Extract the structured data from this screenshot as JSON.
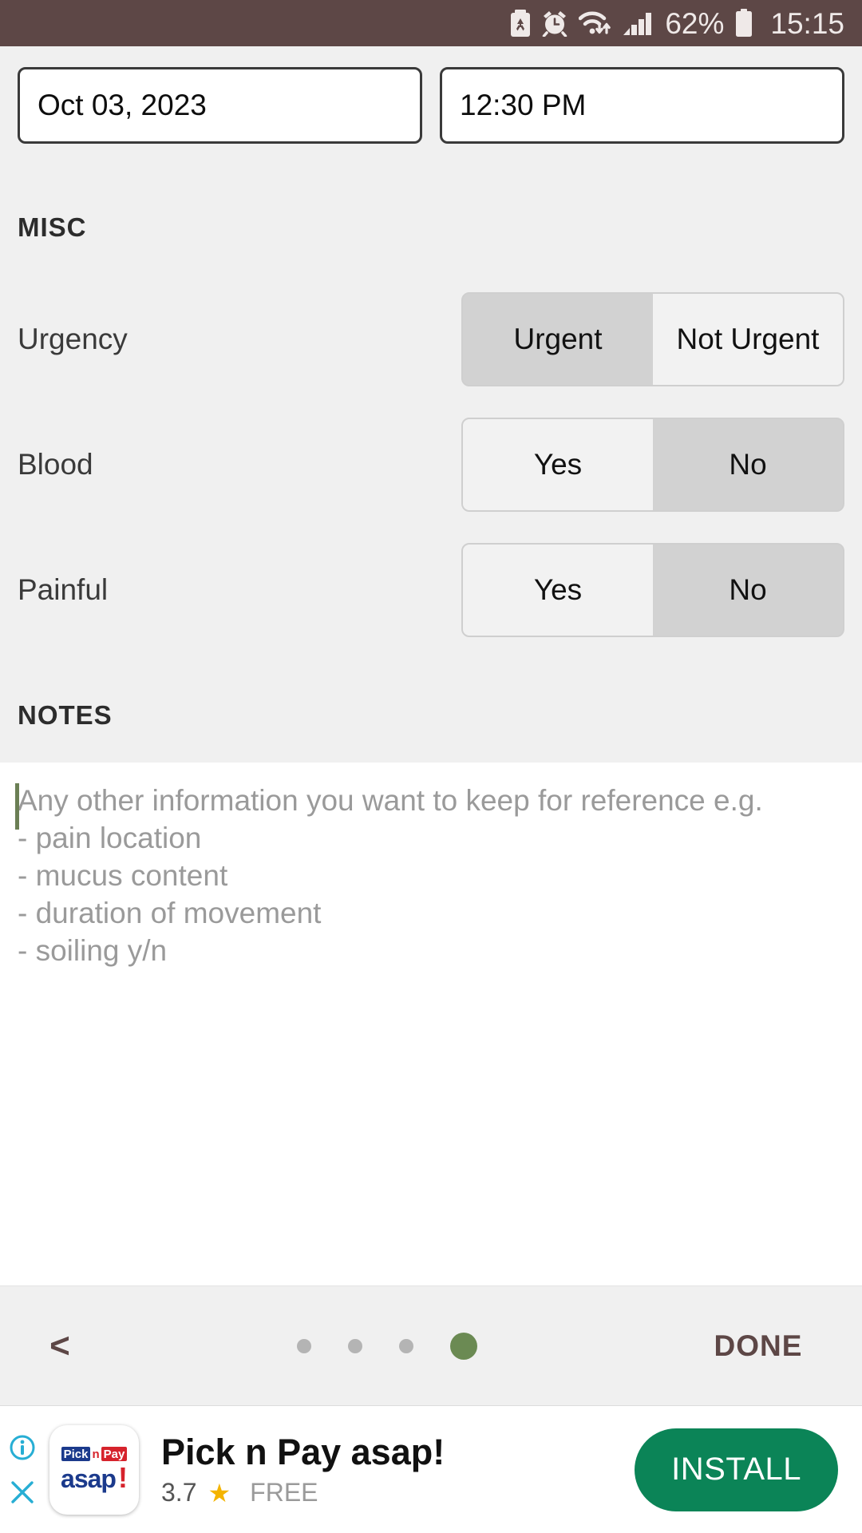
{
  "status_bar": {
    "battery_percent": "62%",
    "time": "15:15",
    "icons": [
      "battery-saver-icon",
      "alarm-clock-icon",
      "wifi-icon",
      "signal-bars-icon",
      "battery-icon"
    ],
    "background_color": "#5d4746",
    "foreground_color": "#efe9e8"
  },
  "datetime": {
    "date_value": "Oct 03, 2023",
    "time_value": "12:30 PM"
  },
  "misc": {
    "header": "MISC",
    "rows": [
      {
        "label": "Urgency",
        "options": [
          "Urgent",
          "Not Urgent"
        ],
        "selected_index": 1
      },
      {
        "label": "Blood",
        "options": [
          "Yes",
          "No"
        ],
        "selected_index": 0
      },
      {
        "label": "Painful",
        "options": [
          "Yes",
          "No"
        ],
        "selected_index": 0
      }
    ]
  },
  "notes": {
    "header": "NOTES",
    "placeholder": "Any other information you want to keep for reference e.g.\n- pain location\n- mucus content\n- duration of movement\n- soiling y/n",
    "value": "",
    "caret_color": "#6b7f55"
  },
  "bottom_nav": {
    "back_label": "<",
    "done_label": "DONE",
    "pager": {
      "total": 4,
      "active_index": 3,
      "active_color": "#6b8a53",
      "inactive_color": "#b4b4b4"
    },
    "accent_color": "#5d4746"
  },
  "ad": {
    "logo_top_left": "Pick",
    "logo_top_mid": "n",
    "logo_top_right": "Pay",
    "logo_bottom": "asap",
    "logo_bang": "!",
    "title": "Pick n Pay asap!",
    "rating": "3.7",
    "star": "★",
    "price": "FREE",
    "install_label": "INSTALL",
    "install_color": "#0b8457",
    "info_icon": "info-icon",
    "close_icon": "close-icon"
  }
}
